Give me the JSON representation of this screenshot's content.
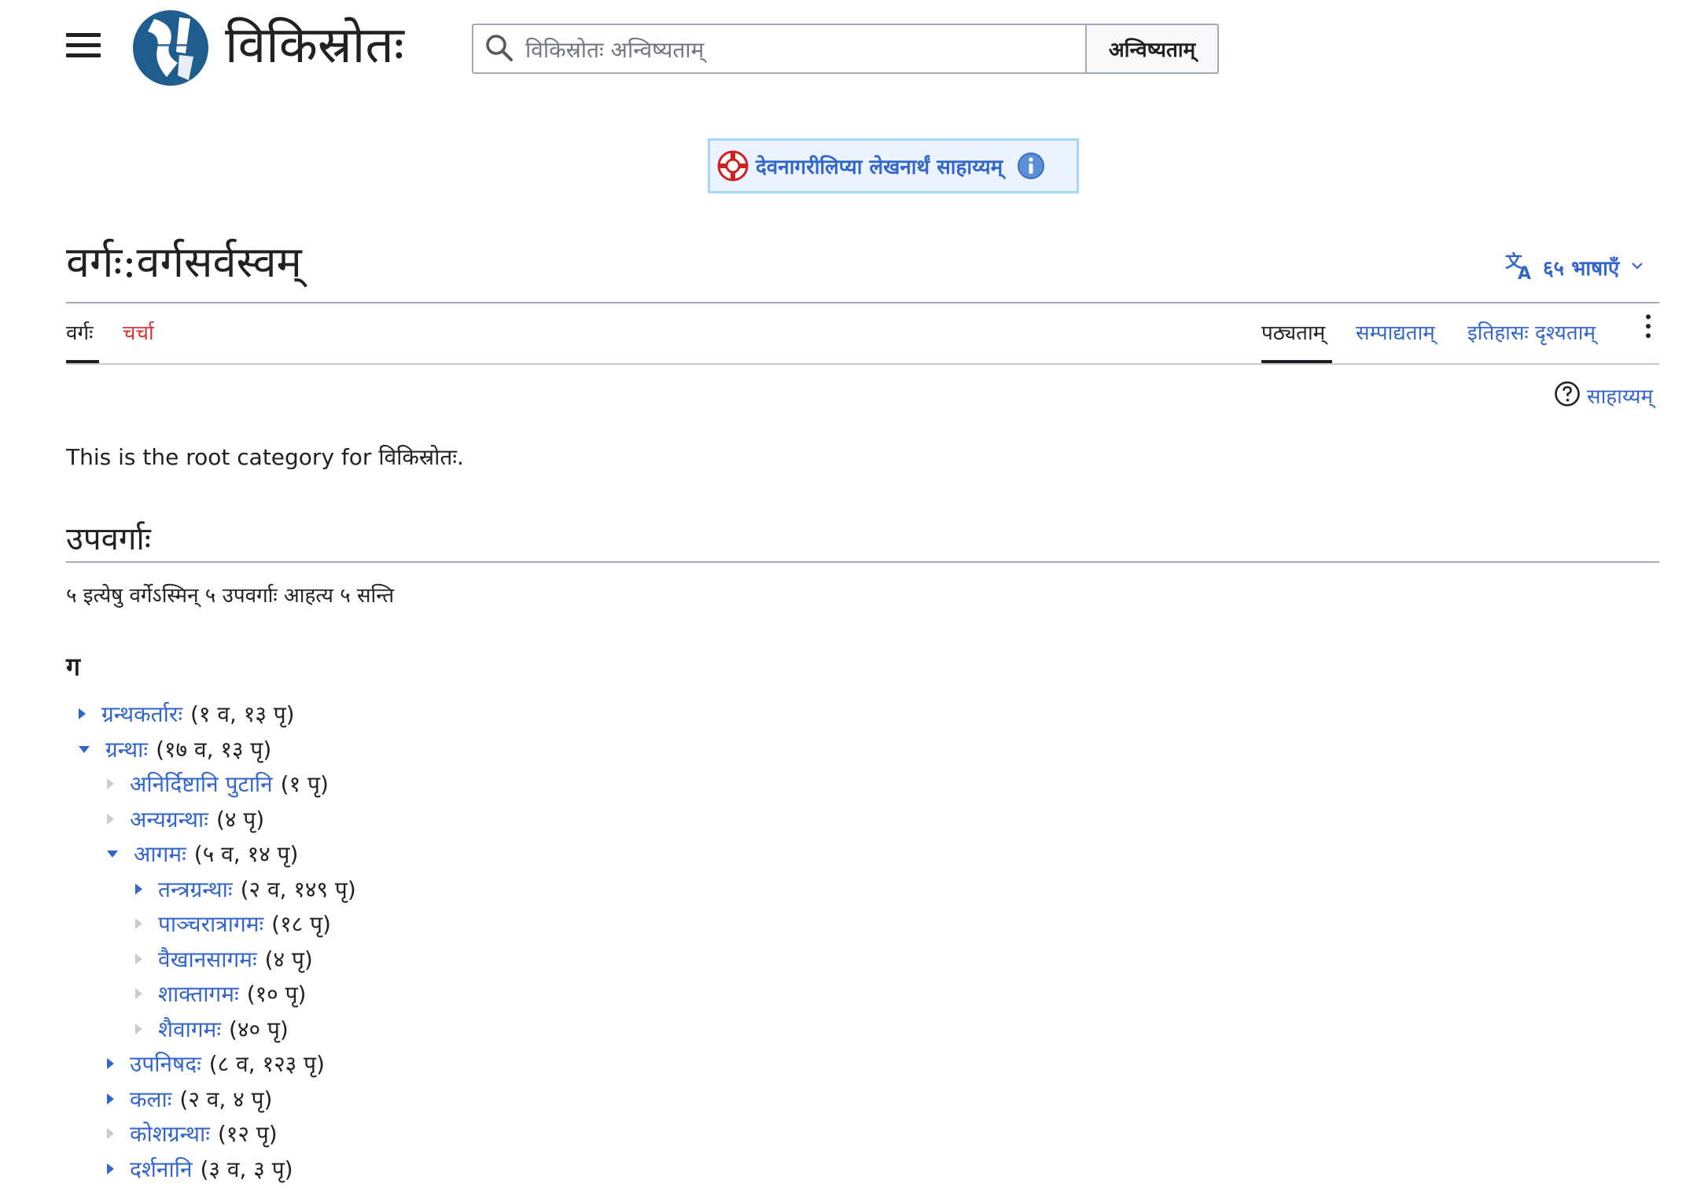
{
  "header": {
    "site_name": "विकिस्रोतः",
    "search": {
      "placeholder": "विकिस्रोतः अन्विष्यताम्",
      "value": "",
      "button_label": "अन्विष्यताम्"
    }
  },
  "notice": {
    "label": "देवनागरीलिप्या लेखनार्थं साहाय्यम्"
  },
  "page": {
    "title": "वर्गः:वर्गसर्वस्वम्",
    "languages_label": "६५ भाषाएँ"
  },
  "tabs": {
    "category": "वर्गः",
    "talk": "चर्चा",
    "read": "पठ्यताम्",
    "edit": "सम्पाद्यताम्",
    "history": "इतिहासः दृश्यताम्"
  },
  "help_label": "साहाय्यम्",
  "content": {
    "intro": "This is the root category for विकिस्रोतः.",
    "subcategories_heading": "उपवर्गाः",
    "subcategories_count": "५ इत्येषु वर्गेऽस्मिन् ५ उपवर्गाः आहत्य ५ सन्ति",
    "letter": "ग"
  },
  "tree": [
    {
      "label": "ग्रन्थकर्तारः",
      "count": "(१ व, १३ पृ)",
      "depth": 0,
      "state": "collapsed"
    },
    {
      "label": "ग्रन्थाः",
      "count": "(१७ व, १३ पृ)",
      "depth": 0,
      "state": "expanded"
    },
    {
      "label": "अनिर्दिष्टानि पुटानि",
      "count": "(१ पृ)",
      "depth": 1,
      "state": "empty"
    },
    {
      "label": "अन्यग्रन्थाः",
      "count": "(४ पृ)",
      "depth": 1,
      "state": "empty"
    },
    {
      "label": "आगमः",
      "count": "(५ व, १४ पृ)",
      "depth": 1,
      "state": "expanded"
    },
    {
      "label": "तन्त्रग्रन्थाः",
      "count": "(२ व, १४९ पृ)",
      "depth": 2,
      "state": "collapsed"
    },
    {
      "label": "पाञ्चरात्रागमः",
      "count": "(१८ पृ)",
      "depth": 2,
      "state": "empty"
    },
    {
      "label": "वैखानसागमः",
      "count": "(४ पृ)",
      "depth": 2,
      "state": "empty"
    },
    {
      "label": "शाक्तागमः",
      "count": "(१० पृ)",
      "depth": 2,
      "state": "empty"
    },
    {
      "label": "शैवागमः",
      "count": "(४० पृ)",
      "depth": 2,
      "state": "empty"
    },
    {
      "label": "उपनिषदः",
      "count": "(८ व, १२३ पृ)",
      "depth": 1,
      "state": "collapsed"
    },
    {
      "label": "कलाः",
      "count": "(२ व, ४ पृ)",
      "depth": 1,
      "state": "collapsed"
    },
    {
      "label": "कोशग्रन्थाः",
      "count": "(१२ पृ)",
      "depth": 1,
      "state": "empty"
    },
    {
      "label": "दर्शनानि",
      "count": "(३ व, ३ पृ)",
      "depth": 1,
      "state": "collapsed"
    }
  ],
  "colors": {
    "link": "#3366cc",
    "link_new": "#d73333",
    "text": "#202122",
    "notice_border": "#a7d7f9"
  },
  "icons": {
    "menu": "hamburger-menu-icon",
    "search": "magnifier-search-icon",
    "notice": "lifebuoy-icon",
    "info": "info-icon",
    "language": "translate-language-icon",
    "more": "vertical-ellipsis-icon",
    "help": "question-circle-icon"
  }
}
